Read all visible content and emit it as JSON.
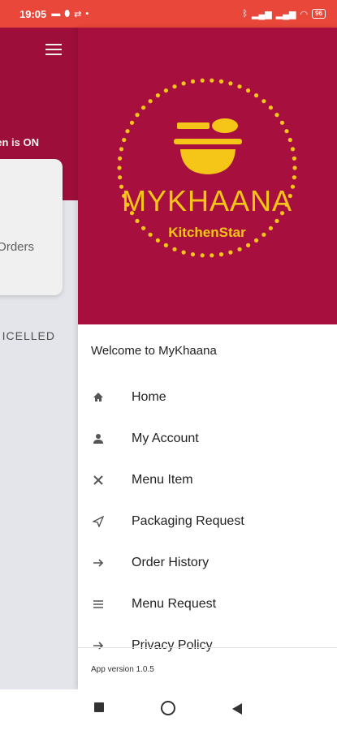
{
  "status_bar": {
    "time": "19:05",
    "left_icons": [
      "message-icon",
      "location-icon",
      "usb-icon",
      "dot-icon"
    ],
    "right_icons": [
      "bluetooth-icon",
      "signal-icon",
      "signal-icon",
      "wifi-icon"
    ],
    "battery": "96"
  },
  "background_app": {
    "status_text": "en is ON",
    "card_text": "Orders",
    "cancelled_text": "ICELLED"
  },
  "drawer": {
    "brand_color": "#a7103e",
    "accent_color": "#f5c518",
    "logo_title": "MYKHAANA",
    "logo_subtitle": "KitchenStar",
    "welcome": "Welcome to MyKhaana",
    "menu": [
      {
        "label": "Home",
        "icon": "home-icon"
      },
      {
        "label": "My Account",
        "icon": "person-icon"
      },
      {
        "label": "Menu Item",
        "icon": "utensils-icon"
      },
      {
        "label": "Packaging Request",
        "icon": "send-icon"
      },
      {
        "label": "Order History",
        "icon": "arrow-right-icon"
      },
      {
        "label": "Menu Request",
        "icon": "list-icon"
      },
      {
        "label": "Privacy Policy",
        "icon": "arrow-right-icon"
      }
    ],
    "version": "App version 1.0.5"
  }
}
